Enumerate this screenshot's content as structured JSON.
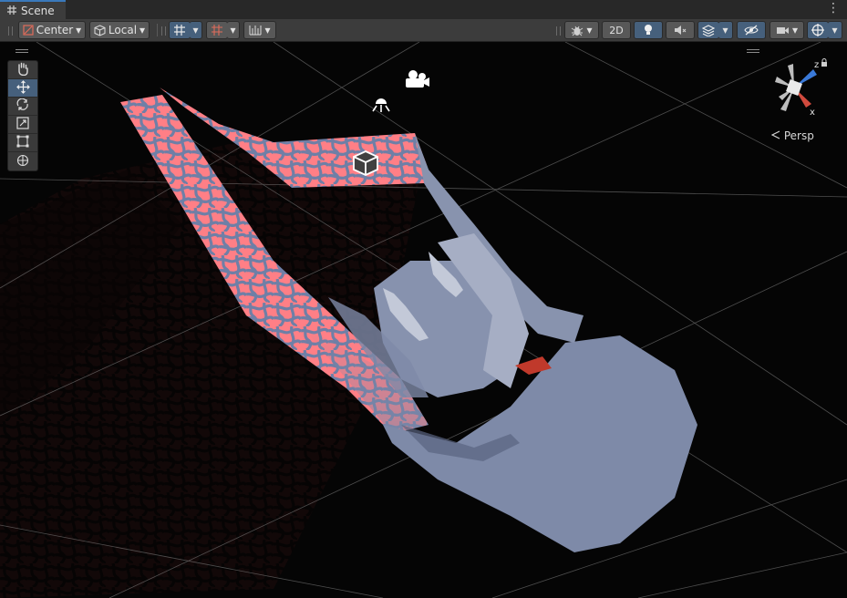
{
  "tab": {
    "title": "Scene",
    "menu_glyph": "⋮"
  },
  "toolbar": {
    "pivot_mode": "Center",
    "pivot_rotation": "Local",
    "mode_2d": "2D",
    "dropdown_glyph": "▾"
  },
  "gizmo": {
    "projection_label": "Persp",
    "axis_x": "x",
    "axis_z": "z"
  },
  "scene": {
    "pattern_color": "#ff7f86",
    "body_color": "#7e8aa8",
    "grid_color": "#9a9a9a",
    "accent_blue": "#3a79bb"
  }
}
